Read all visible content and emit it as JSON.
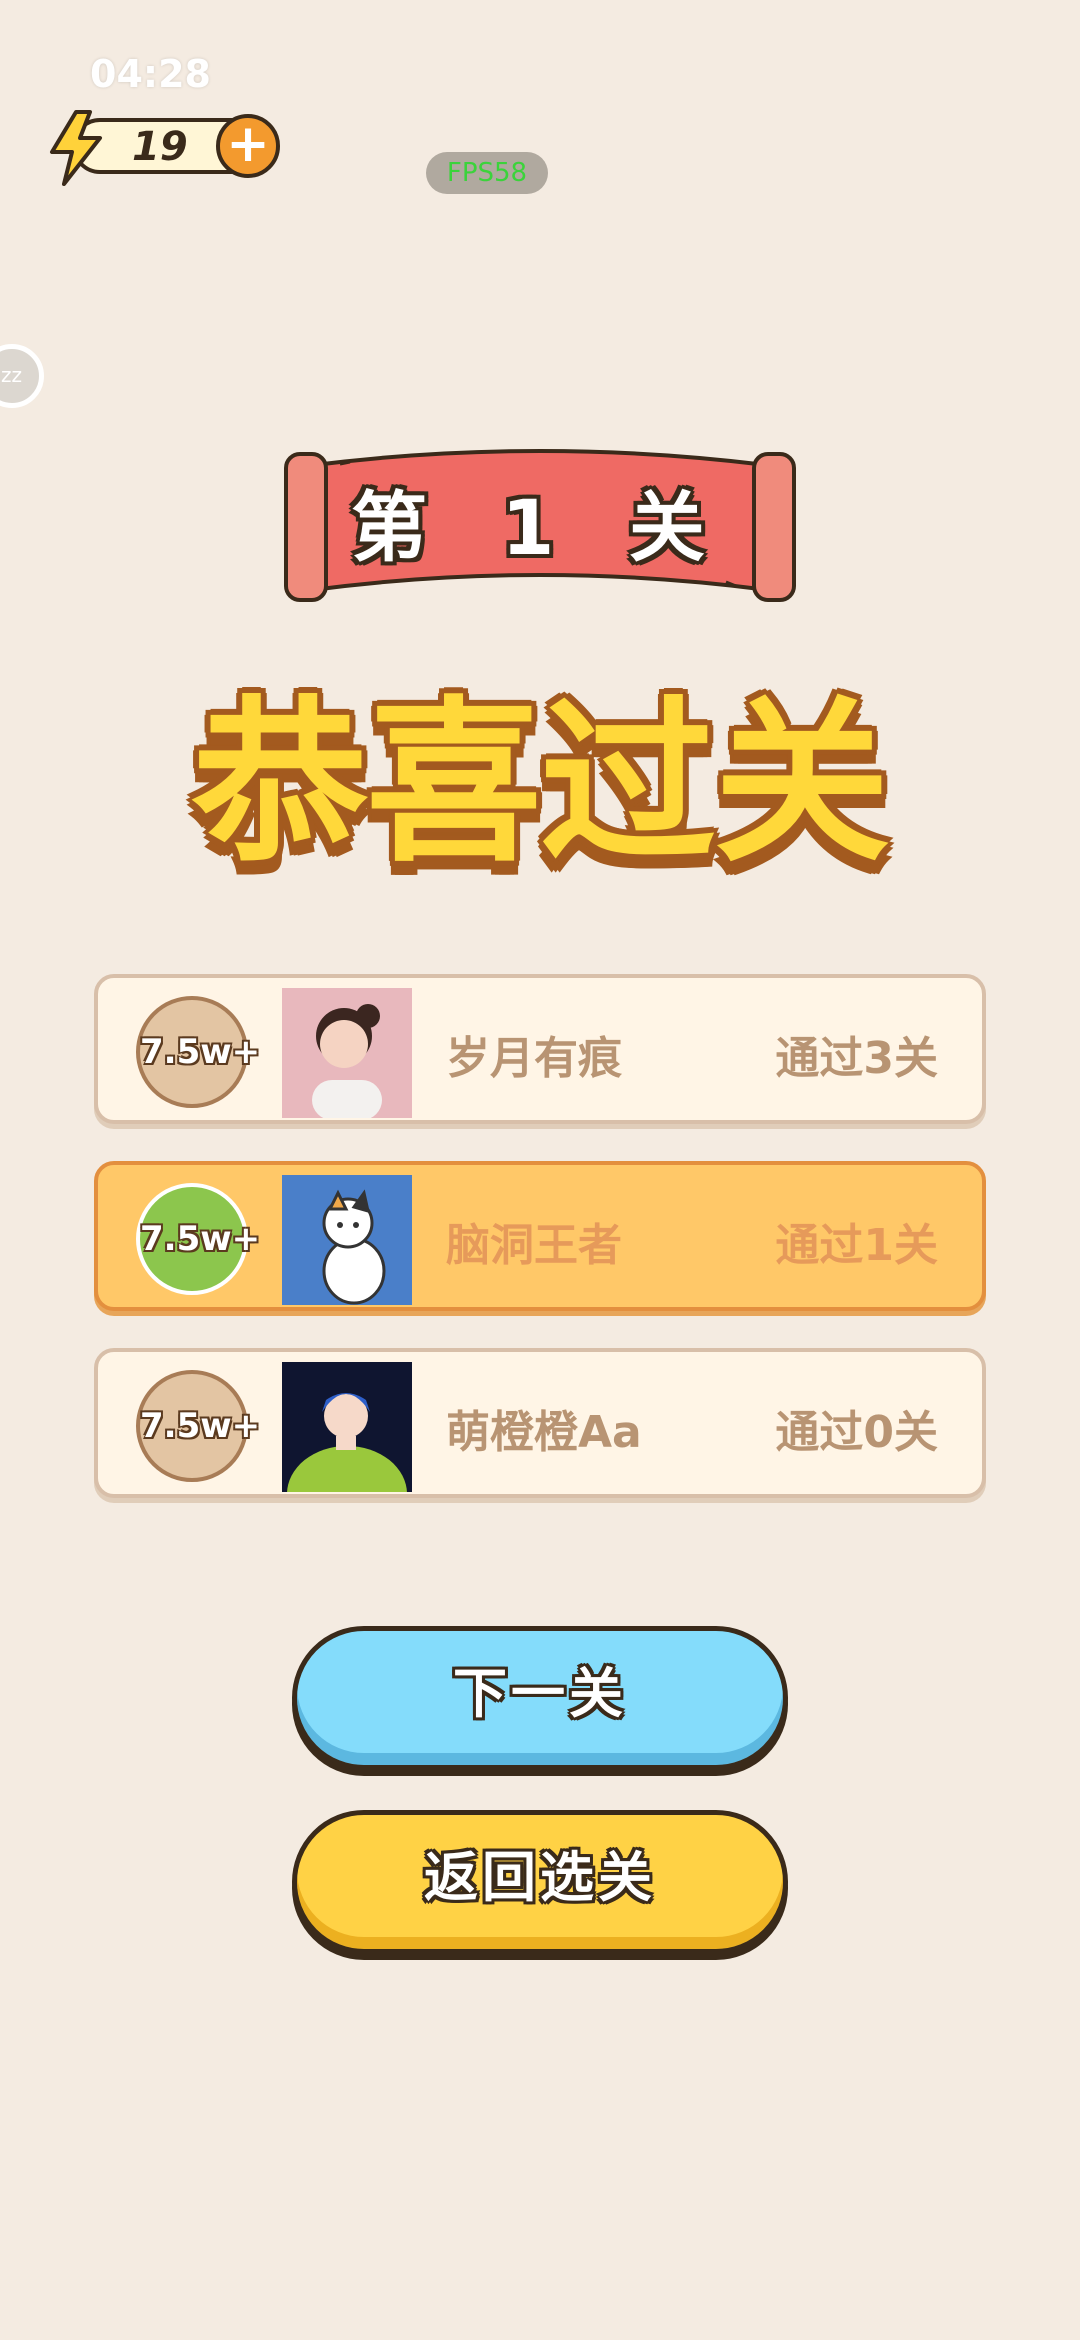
{
  "status_bar": {
    "time": "04:28"
  },
  "energy": {
    "count": "19",
    "add_symbol": "+"
  },
  "debug": {
    "fps": "FPS58"
  },
  "side_handle": {
    "label": "zz"
  },
  "level_banner": {
    "title": "第 1 关"
  },
  "headline": "恭喜过关",
  "leaderboard": [
    {
      "badge": "7.5w+",
      "name": "岁月有痕",
      "progress": "通过3关",
      "highlight": false
    },
    {
      "badge": "7.5w+",
      "name": "脑洞王者",
      "progress": "通过1关",
      "highlight": true
    },
    {
      "badge": "7.5w+",
      "name": "萌橙橙Aa",
      "progress": "通过0关",
      "highlight": false
    }
  ],
  "buttons": {
    "next_level": "下一关",
    "back_to_select": "返回选关"
  },
  "colors": {
    "background": "#f4ebe1",
    "banner_red": "#ef6a64",
    "headline_yellow": "#ffd83a",
    "row_highlight": "#ffc868",
    "next_button": "#84dcfb",
    "back_button": "#ffd245"
  }
}
